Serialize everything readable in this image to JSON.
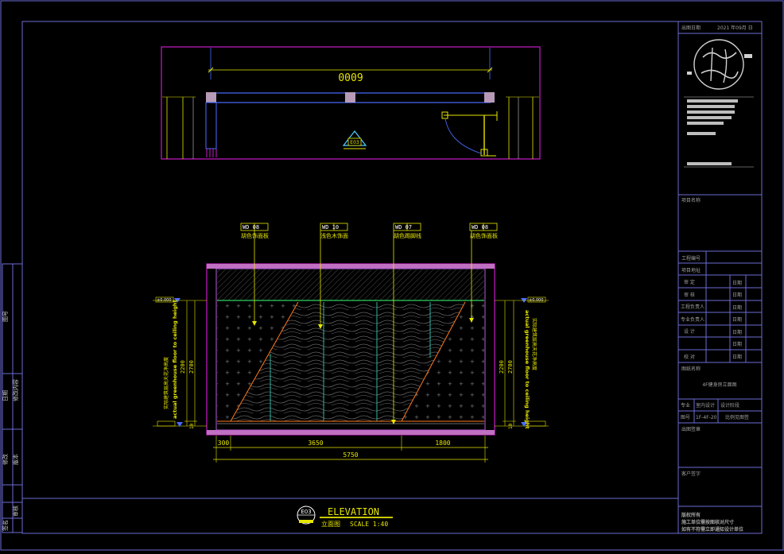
{
  "plan": {
    "overall_dim": "0009",
    "view_tag": "E03"
  },
  "tags": [
    {
      "code": "WD 08",
      "desc": "胡色饰面板"
    },
    {
      "code": "WD 10",
      "desc": "浅色木饰面"
    },
    {
      "code": "WD 07",
      "desc": "胡色踢脚线"
    },
    {
      "code": "WD 08",
      "desc": "胡色饰面板"
    }
  ],
  "elevation": {
    "left_level": "±0.000",
    "right_level": "±0.000",
    "left_vert_en": "actual greenhouse floor to ceiling height",
    "left_vert_cn": "实际建筑层高天花净高度",
    "right_vert_en": "actual greenhouse floor to ceiling height",
    "right_vert_cn": "实际建筑层高天花净高度",
    "dim_2200": "2200",
    "dim_2700": "2700",
    "dim_10": "10",
    "dim_300": "300",
    "dim_3650": "3650",
    "dim_1800": "1800",
    "dim_5750": "5750"
  },
  "title_block": {
    "tag": "E03",
    "title_en": "ELEVATION",
    "title_cn": "立面图",
    "scale": "SCALE 1:40"
  },
  "left_strip": {
    "labels": [
      "图号",
      "修改内容",
      "日期",
      "版本",
      "修改",
      "审核",
      "签名"
    ]
  },
  "right_panel": {
    "date_label": "出图日期",
    "date_value": "2021 年09月 日",
    "project_name_label": "项目名称",
    "project_no_label": "工程编号",
    "project_addr_label": "项目地址",
    "rows": [
      {
        "role": "审 定",
        "date": "日期"
      },
      {
        "role": "审 核",
        "date": "日期"
      },
      {
        "role": "工程负责人",
        "date": "日期"
      },
      {
        "role": "专业负责人",
        "date": "日期"
      },
      {
        "role": "设 计",
        "date": "日期"
      },
      {
        "role": "",
        "date": "日期"
      },
      {
        "role": "校 对",
        "date": "日期"
      }
    ],
    "drawing_name_label": "图纸名称",
    "drawing_name": "4F健身房立面图",
    "spec_label": "专业",
    "spec_value": "室内设计",
    "stage_label": "设计阶段",
    "drawing_no_label": "图号",
    "drawing_no": "1F-4F-20",
    "stage_value": "比例见图签",
    "stamp_label": "出图签章",
    "client_label": "客户签字",
    "notes": [
      "版权所有",
      "施工单位需按图核对尺寸",
      "如有不符需立即通知设计单位"
    ]
  }
}
